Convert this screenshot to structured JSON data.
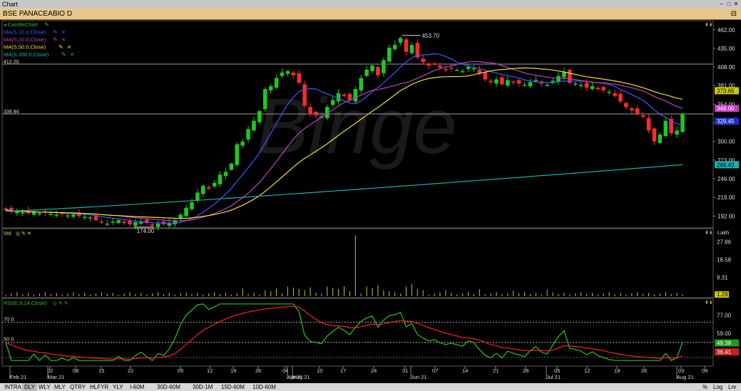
{
  "window": {
    "title": "Chart"
  },
  "symbol": {
    "label": "BSE PANACEABIO D"
  },
  "price_panel": {
    "indicators": [
      {
        "label": "CandleChart",
        "color": "#1ec81e"
      },
      {
        "label": "MA(S,10.0,Close)",
        "color": "#3c5aff"
      },
      {
        "label": "MA(S,20.0,Close)",
        "color": "#c040c0"
      },
      {
        "label": "MA(S,50.0,Close)",
        "color": "#f0e030"
      },
      {
        "label": "MA(S,200.0,Close)",
        "color": "#1ab0b0"
      }
    ],
    "hlines": [
      {
        "label": "412.20",
        "value": 412.2
      },
      {
        "label": "339.94",
        "value": 339.94
      }
    ],
    "high_label": "453.70",
    "low_label": "174.00",
    "watermark": "Binge",
    "axis_ticks": [
      "462.00",
      "435.00",
      "408.00",
      "381.00",
      "354.00",
      "327.00",
      "300.00",
      "273.00",
      "246.00",
      "219.00",
      "192.00"
    ],
    "value_tags": [
      {
        "label": "373.65",
        "value": 373.65,
        "bg": "#c9c900",
        "fg": "#000"
      },
      {
        "label": "348.00",
        "value": 348.0,
        "bg": "#c040c0",
        "fg": "#fff"
      },
      {
        "label": "329.45",
        "value": 329.45,
        "bg": "#1e2cc8",
        "fg": "#fff"
      },
      {
        "label": "266.43",
        "value": 266.43,
        "bg": "#1ab0b0",
        "fg": "#000"
      }
    ]
  },
  "volume_panel": {
    "label": "Vol",
    "unit": "Lakh",
    "axis_ticks": [
      "27.86",
      "18.58",
      "9.31"
    ],
    "last_tag": "1.29"
  },
  "rsi_panel": {
    "label": "RSI(E,9,14,Close)",
    "axis_ticks": [
      "77.00",
      "59.00"
    ],
    "levels": [
      "70.0",
      "50.0"
    ],
    "tags": [
      {
        "label": "49.38",
        "bg": "#1a9e1a"
      },
      {
        "label": "36.41",
        "bg": "#c81e1e"
      }
    ]
  },
  "x_axis": {
    "labels": [
      "Feb 21",
      "02",
      "08",
      "15",
      "22",
      "Mar 21",
      "05",
      "12",
      "19",
      "26",
      "Apr 21",
      "04",
      "10",
      "17",
      "24",
      "May 21",
      "31",
      "07",
      "14",
      "21",
      "28",
      "Jun 21",
      "05",
      "12",
      "19",
      "26",
      "Jul 21",
      "03",
      "09",
      "Aug 21"
    ]
  },
  "bottom_bar": {
    "items": [
      "INTRA",
      "DLY",
      "WLY",
      "MLY",
      "QTRY",
      "HLFYR",
      "YLY",
      "I-60M",
      "30D-60M",
      "30D-1M",
      "15D-60M",
      "10D-60M"
    ],
    "right": [
      "%",
      "Log",
      "Lnr"
    ],
    "active": "DLY"
  },
  "chart_data": {
    "type": "candlestick",
    "dates_note": "daily",
    "ohlc_close": [
      201,
      198,
      199,
      197,
      196,
      198,
      196,
      197,
      195,
      194,
      195,
      193,
      194,
      192,
      191,
      190,
      186,
      183,
      181,
      184,
      186,
      182,
      180,
      183,
      184,
      182,
      178,
      181,
      180,
      182,
      186,
      194,
      204,
      212,
      226,
      236,
      232,
      240,
      252,
      256,
      268,
      296,
      300,
      318,
      330,
      344,
      376,
      380,
      392,
      400,
      402,
      396,
      385,
      352,
      340,
      338,
      336,
      350,
      360,
      370,
      366,
      360,
      376,
      392,
      404,
      410,
      396,
      418,
      436,
      440,
      450,
      430,
      440,
      422,
      415,
      410,
      412,
      407,
      404,
      406,
      404,
      402,
      408,
      406,
      398,
      390,
      386,
      390,
      383,
      389,
      386,
      384,
      382,
      386,
      389,
      384,
      382,
      388,
      395,
      401,
      385,
      384,
      382,
      378,
      380,
      376,
      374,
      372,
      366,
      358,
      350,
      345,
      340,
      336,
      316,
      300,
      310,
      330,
      312,
      316,
      340
    ],
    "ma200_end": 266.43,
    "ma50_end": 373.65,
    "ma20_end": 348.0,
    "ma10_end": 329.45,
    "y_range": [
      180,
      470
    ],
    "volume_spike": 31.0,
    "rsi_range": [
      30,
      90
    ]
  }
}
